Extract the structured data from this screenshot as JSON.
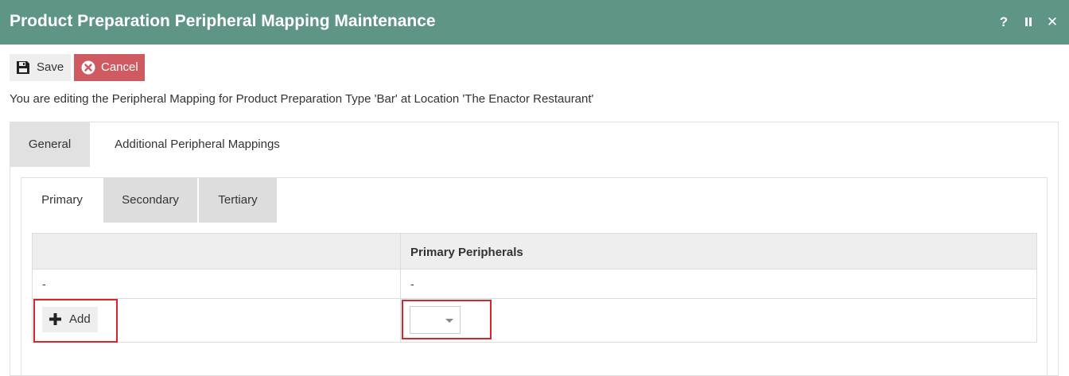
{
  "window": {
    "title": "Product Preparation Peripheral Mapping Maintenance",
    "controls": [
      {
        "name": "help",
        "label": "?"
      },
      {
        "name": "pause",
        "label": ""
      },
      {
        "name": "close",
        "label": "✕"
      }
    ]
  },
  "toolbar": {
    "save_label": "Save",
    "cancel_label": "Cancel"
  },
  "info_text": "You are editing the Peripheral Mapping for Product Preparation Type 'Bar' at Location 'The Enactor Restaurant'",
  "outer_tabs": [
    {
      "label": "General",
      "active": true
    },
    {
      "label": "Additional Peripheral Mappings",
      "active": false
    }
  ],
  "inner_tabs": [
    {
      "label": "Primary",
      "active": true
    },
    {
      "label": "Secondary",
      "active": false
    },
    {
      "label": "Tertiary",
      "active": false
    }
  ],
  "grid": {
    "headers": [
      "",
      "Primary Peripherals"
    ],
    "rows": [
      [
        "-",
        "-"
      ]
    ],
    "add_label": "Add",
    "select_value": ""
  },
  "colors": {
    "titlebar": "#5e9585",
    "cancel": "#d05a62",
    "highlight": "#d9232d"
  }
}
